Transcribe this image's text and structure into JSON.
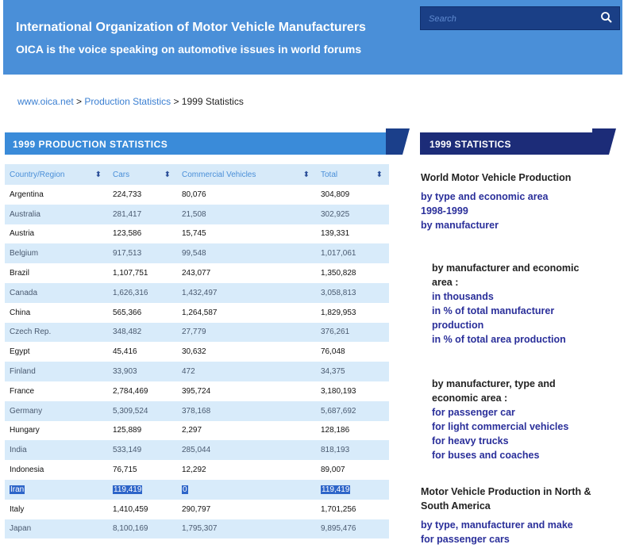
{
  "header": {
    "title": "International Organization of Motor Vehicle Manufacturers",
    "subtitle": "OICA is the voice speaking on automotive issues in world forums"
  },
  "search": {
    "placeholder": "Search",
    "icon": "search-icon"
  },
  "breadcrumb": {
    "home": "www.oica.net",
    "sep1": " > ",
    "section": "Production Statistics",
    "sep2": " > ",
    "current": "1999 Statistics"
  },
  "left_section": {
    "title": "1999 PRODUCTION STATISTICS"
  },
  "table": {
    "columns": [
      "Country/Region",
      "Cars",
      "Commercial Vehicles",
      "Total"
    ],
    "sort_glyph": "⬍",
    "rows": [
      [
        "Argentina",
        "224,733",
        "80,076",
        "304,809"
      ],
      [
        "Australia",
        "281,417",
        "21,508",
        "302,925"
      ],
      [
        "Austria",
        "123,586",
        "15,745",
        "139,331"
      ],
      [
        "Belgium",
        "917,513",
        "99,548",
        "1,017,061"
      ],
      [
        "Brazil",
        "1,107,751",
        "243,077",
        "1,350,828"
      ],
      [
        "Canada",
        "1,626,316",
        "1,432,497",
        "3,058,813"
      ],
      [
        "China",
        "565,366",
        "1,264,587",
        "1,829,953"
      ],
      [
        "Czech Rep.",
        "348,482",
        "27,779",
        "376,261"
      ],
      [
        "Egypt",
        "45,416",
        "30,632",
        "76,048"
      ],
      [
        "Finland",
        "33,903",
        "472",
        "34,375"
      ],
      [
        "France",
        "2,784,469",
        "395,724",
        "3,180,193"
      ],
      [
        "Germany",
        "5,309,524",
        "378,168",
        "5,687,692"
      ],
      [
        "Hungary",
        "125,889",
        "2,297",
        "128,186"
      ],
      [
        "India",
        "533,149",
        "285,044",
        "818,193"
      ],
      [
        "Indonesia",
        "76,715",
        "12,292",
        "89,007"
      ],
      [
        "Iran",
        "119,419",
        "0",
        "119,419"
      ],
      [
        "Italy",
        "1,410,459",
        "290,797",
        "1,701,256"
      ],
      [
        "Japan",
        "8,100,169",
        "1,795,307",
        "9,895,476"
      ]
    ]
  },
  "sidebar": {
    "title": "1999 STATISTICS",
    "block1": {
      "heading": "World Motor Vehicle Production",
      "links": [
        "by type and economic area",
        "1998-1999",
        "by manufacturer"
      ]
    },
    "block2": {
      "heading": "by manufacturer and economic area :",
      "links": [
        "in thousands",
        "in % of total manufacturer production",
        "in % of total area production"
      ]
    },
    "block3": {
      "heading": "by manufacturer, type and economic area :",
      "links": [
        "for passenger car",
        "for light commercial vehicles",
        "for heavy trucks",
        "for buses and coaches"
      ]
    },
    "block4": {
      "heading": "Motor Vehicle Production in North & South America",
      "links": [
        "by type, manufacturer and make",
        "for passenger cars"
      ]
    }
  },
  "colors": {
    "header_bg": "#4a8fd8",
    "search_bg": "#1a3f86",
    "table_header_bg": "#3a8bd9",
    "sidebar_header_bg": "#1c2c78",
    "link": "#2a2f9a",
    "highlight": "#2d65c9"
  }
}
